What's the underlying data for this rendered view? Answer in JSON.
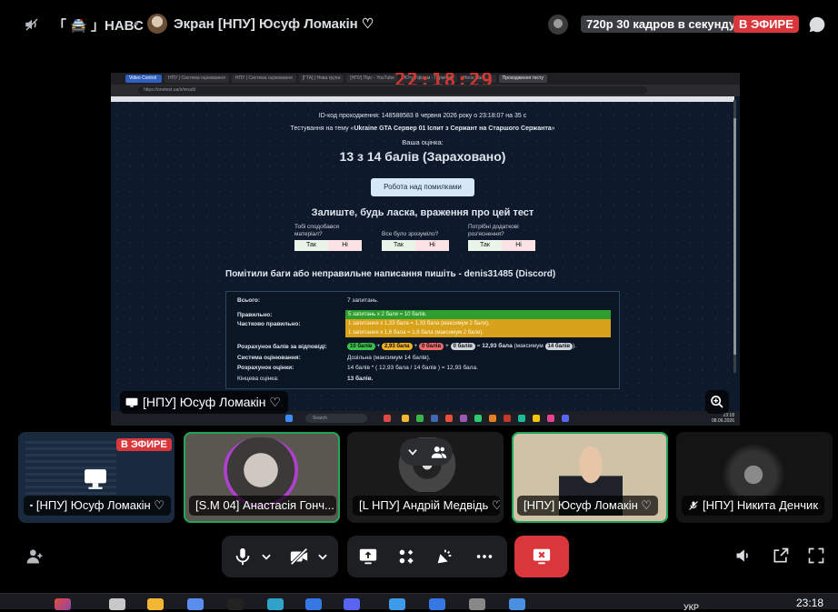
{
  "header": {
    "server_name": "「 🚔 」НАВС",
    "screen_title": "Экран [НПУ] Юсуф Ломакін ♡",
    "quality_badge": "720р 30 кадров в секунду",
    "live_badge": "В ЭФИРЕ"
  },
  "stream": {
    "clock_overlay": "22:18:29",
    "tabs": [
      "Video Control",
      "НПУ | Система оцінювання",
      "НПУ | Система оцінювання",
      "[ГТА] | Нова група",
      "[НПУ] Пірс - YouTube",
      "Ютуб фільм - Гармоній",
      "Неон Вал",
      "Проходження тесту"
    ],
    "url": "https://onetest.ua/s/result/",
    "page": {
      "meta_line": "ID-код проходження: 148588583 8 червня 2026 року о 23:18:07 на 35 с",
      "topic_prefix": "Тестування на тему «",
      "topic_name": "Ukraine GTA Сервер 01 Іспит з Сержант на Старшого Сержанта",
      "topic_suffix": "»",
      "score_label": "Ваша оцінка:",
      "score": "13 з 14 балів (Зараховано)",
      "review_button": "Робота над помилками",
      "feedback_title": "Залиште, будь ласка, враження про цей тест",
      "feedback": [
        {
          "question": "Тобі сподобався матеріал?",
          "yes": "Так",
          "no": "Ні"
        },
        {
          "question": "Все було зрозуміло?",
          "yes": "Так",
          "no": "Ні"
        },
        {
          "question": "Потрібні додаткові роз'яснення?",
          "yes": "Так",
          "no": "Ні"
        }
      ],
      "bugs_note": "Помітили баги або неправильне написання пишіть - denis31485 (Discord)",
      "summary": {
        "total_label": "Всього:",
        "total_value": "7 запитань.",
        "correct_label": "Правильно:",
        "correct_value": "5 запитань x 2 бали = 10 балів.",
        "partial_label": "Частково правильно:",
        "partial_value_1": "1 запитання x 1,33 бала = 1,33 бала (максимум 2 бали),",
        "partial_value_2": "1 запитання x 1,6 бала = 1,6 бала (максимум 2 бали).",
        "calc_label": "Розрахунок балів за відповіді:",
        "calc_pills": [
          "10 балів",
          "2,93 бала",
          "0 балів",
          "0 балів"
        ],
        "calc_ops": [
          "+",
          "+",
          "+",
          "="
        ],
        "calc_result": "12,93 бала",
        "calc_max_prefix": "(максимум",
        "calc_max": "14 балів",
        "calc_max_suffix": ").",
        "system_label": "Система оцінювання:",
        "system_value": "Дозільна (максимум 14 балів).",
        "grade_calc_label": "Розрахунок оцінки:",
        "grade_calc_value": "14 балів * ( 12,93 бала / 14 балів ) = 12,93 бала.",
        "final_label": "Кінцева оцінка:",
        "final_value": "13 балів."
      }
    },
    "inner_taskbar": {
      "search": "Search",
      "time": "23:18",
      "date": "08.06.2026"
    },
    "label": "[НПУ] Юсуф Ломакін ♡"
  },
  "participants": [
    {
      "name": "[НПУ] Юсуф Ломакін ♡",
      "live": "В ЭФИРЕ",
      "kind": "screen"
    },
    {
      "name": "[S.M 04] Анастасія Гонч...",
      "kind": "camera",
      "speaking": true
    },
    {
      "name": "[L НПУ] Андрій Медвідь ♡",
      "kind": "avatar"
    },
    {
      "name": "[НПУ] Юсуф Ломакін ♡",
      "kind": "camera",
      "speaking": true
    },
    {
      "name": "[НПУ] Никита Денчик",
      "kind": "avatar",
      "muted": true
    }
  ],
  "tray": {
    "lang": "УКР",
    "time": "23:18"
  },
  "colors": {
    "live": "#da373c",
    "speaking": "#23a559",
    "correct": "#2e9e2e",
    "partial": "#d9a21b"
  }
}
